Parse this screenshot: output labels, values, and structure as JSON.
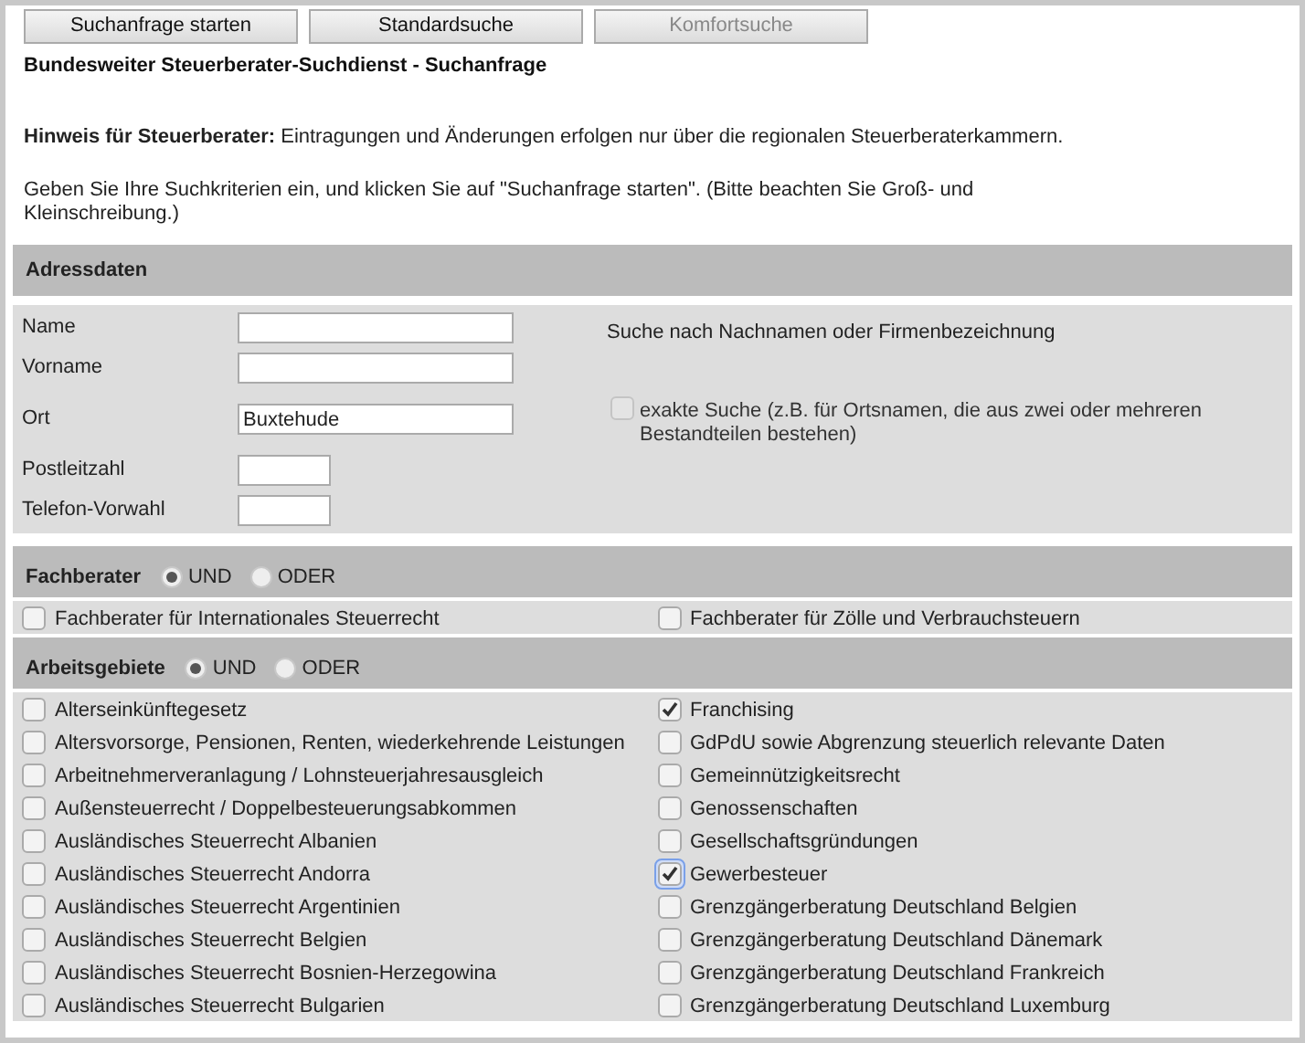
{
  "buttons": [
    {
      "label": "Suchanfrage starten",
      "disabled": false
    },
    {
      "label": "Standardsuche",
      "disabled": false
    },
    {
      "label": "Komfortsuche",
      "disabled": true
    }
  ],
  "title": "Bundesweiter Steuerberater-Suchdienst - Suchanfrage",
  "notice": "**Hinweis für Steuerberater:** Eintragungen und Änderungen erfolgen nur über die regionalen Steuerberaterkammern.",
  "instructions": "Geben Sie Ihre Suchkriterien ein, und klicken Sie auf \"Suchanfrage starten\". (Bitte beachten Sie Groß- und Kleinschreibung.)",
  "address": {
    "heading": "Adressdaten",
    "fields": [
      {
        "label": "Name",
        "kind": "long"
      },
      {
        "label": "Vorname",
        "kind": "long"
      },
      {
        "label": "Ort",
        "value": "Buxtehude",
        "kind": "long"
      },
      {
        "label": "Postleitzahl",
        "kind": "short"
      },
      {
        "label": "Telefon-Vorwahl",
        "kind": "short"
      }
    ],
    "name_hint": "Suche nach Nachnamen oder Firmenbezeichnung",
    "exact": {
      "label": "exakte Suche (z.B. für Ortsnamen, die aus zwei oder mehreren Bestandteilen bestehen)",
      "checked": false,
      "disabled": true
    }
  },
  "sections": [
    {
      "heading": "Fachberater",
      "modes": [
        {
          "label": "UND",
          "selected": true
        },
        {
          "label": "ODER",
          "selected": false
        }
      ],
      "items": [
        {
          "label": "Fachberater für Internationales Steuerrecht",
          "checked": false,
          "focused": false
        },
        {
          "label": "Fachberater für Zölle und Verbrauchsteuern",
          "checked": false,
          "focused": false
        }
      ]
    },
    {
      "heading": "Arbeitsgebiete",
      "modes": [
        {
          "label": "UND",
          "selected": true
        },
        {
          "label": "ODER",
          "selected": false
        }
      ],
      "items": [
        {
          "label": "Alterseinkünftegesetz",
          "checked": false,
          "focused": false
        },
        {
          "label": "Franchising",
          "checked": true,
          "focused": false
        },
        {
          "label": "Altersvorsorge, Pensionen, Renten, wiederkehrende Leistungen",
          "checked": false,
          "focused": false
        },
        {
          "label": "GdPdU sowie Abgrenzung steuerlich relevante Daten",
          "checked": false,
          "focused": false
        },
        {
          "label": "Arbeitnehmerveranlagung / Lohnsteuerjahresausgleich",
          "checked": false,
          "focused": false
        },
        {
          "label": "Gemeinnützigkeitsrecht",
          "checked": false,
          "focused": false
        },
        {
          "label": "Außensteuerrecht / Doppelbesteuerungsabkommen",
          "checked": false,
          "focused": false
        },
        {
          "label": "Genossenschaften",
          "checked": false,
          "focused": false
        },
        {
          "label": "Ausländisches Steuerrecht Albanien",
          "checked": false,
          "focused": false
        },
        {
          "label": "Gesellschaftsgründungen",
          "checked": false,
          "focused": false
        },
        {
          "label": "Ausländisches Steuerrecht Andorra",
          "checked": false,
          "focused": false
        },
        {
          "label": "Gewerbesteuer",
          "checked": true,
          "focused": true
        },
        {
          "label": "Ausländisches Steuerrecht Argentinien",
          "checked": false,
          "focused": false
        },
        {
          "label": "Grenzgängerberatung Deutschland Belgien",
          "checked": false,
          "focused": false
        },
        {
          "label": "Ausländisches Steuerrecht Belgien",
          "checked": false,
          "focused": false
        },
        {
          "label": "Grenzgängerberatung Deutschland Dänemark",
          "checked": false,
          "focused": false
        },
        {
          "label": "Ausländisches Steuerrecht Bosnien-Herzegowina",
          "checked": false,
          "focused": false
        },
        {
          "label": "Grenzgängerberatung Deutschland Frankreich",
          "checked": false,
          "focused": false
        },
        {
          "label": "Ausländisches Steuerrecht Bulgarien",
          "checked": false,
          "focused": false
        },
        {
          "label": "Grenzgängerberatung Deutschland Luxemburg",
          "checked": false,
          "focused": false
        }
      ]
    }
  ]
}
